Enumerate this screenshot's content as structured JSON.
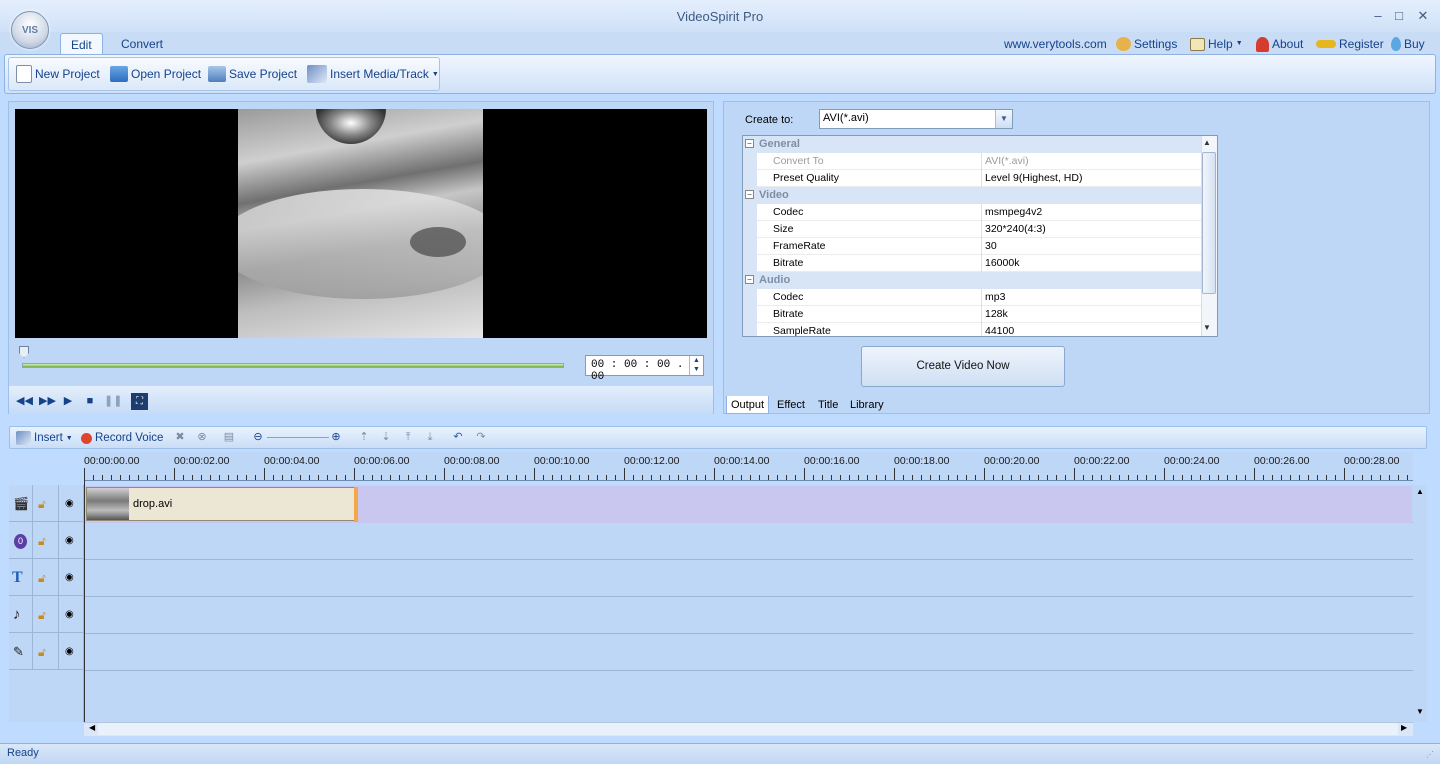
{
  "window": {
    "title": "VideoSpirit Pro",
    "logo_text": "VIS",
    "minimize": "‒",
    "maximize": "□",
    "close": "✕"
  },
  "tabs": [
    "Edit",
    "Convert"
  ],
  "right_links": {
    "site": "www.verytools.com",
    "settings": "Settings",
    "help": "Help",
    "about": "About",
    "register": "Register",
    "buy": "Buy"
  },
  "ribbon": {
    "new_project": "New Project",
    "open_project": "Open Project",
    "save_project": "Save Project",
    "insert_media": "Insert Media/Track"
  },
  "preview": {
    "timecode": "00 : 00 : 00 . 00",
    "progress_fraction": 0.0
  },
  "properties": {
    "create_to_label": "Create to:",
    "create_to_value": "AVI(*.avi)",
    "categories": {
      "general": "General",
      "video": "Video",
      "audio": "Audio"
    },
    "general": [
      {
        "key": "Convert To",
        "value": "AVI(*.avi)"
      },
      {
        "key": "Preset Quality",
        "value": "Level 9(Highest, HD)"
      }
    ],
    "video": [
      {
        "key": "Codec",
        "value": "msmpeg4v2"
      },
      {
        "key": "Size",
        "value": "320*240(4:3)"
      },
      {
        "key": "FrameRate",
        "value": "30"
      },
      {
        "key": "Bitrate",
        "value": "16000k"
      }
    ],
    "audio": [
      {
        "key": "Codec",
        "value": "mp3"
      },
      {
        "key": "Bitrate",
        "value": "128k"
      },
      {
        "key": "SampleRate",
        "value": "44100"
      }
    ],
    "create_button": "Create Video Now",
    "bottom_tabs": [
      "Output",
      "Effect",
      "Title",
      "Library"
    ]
  },
  "timeline": {
    "insert": "Insert",
    "record_voice": "Record Voice",
    "ruler_labels": [
      "00:00:00.00",
      "00:00:02.00",
      "00:00:04.00",
      "00:00:06.00",
      "00:00:08.00",
      "00:00:10.00",
      "00:00:12.00",
      "00:00:14.00",
      "00:00:16.00",
      "00:00:18.00",
      "00:00:20.00",
      "00:00:22.00",
      "00:00:24.00",
      "00:00:26.00",
      "00:00:28.00"
    ],
    "clip_name": "drop.avi",
    "tracks": [
      "video-track",
      "effect-track",
      "title-track",
      "music-track",
      "voice-track"
    ]
  },
  "status": "Ready"
}
